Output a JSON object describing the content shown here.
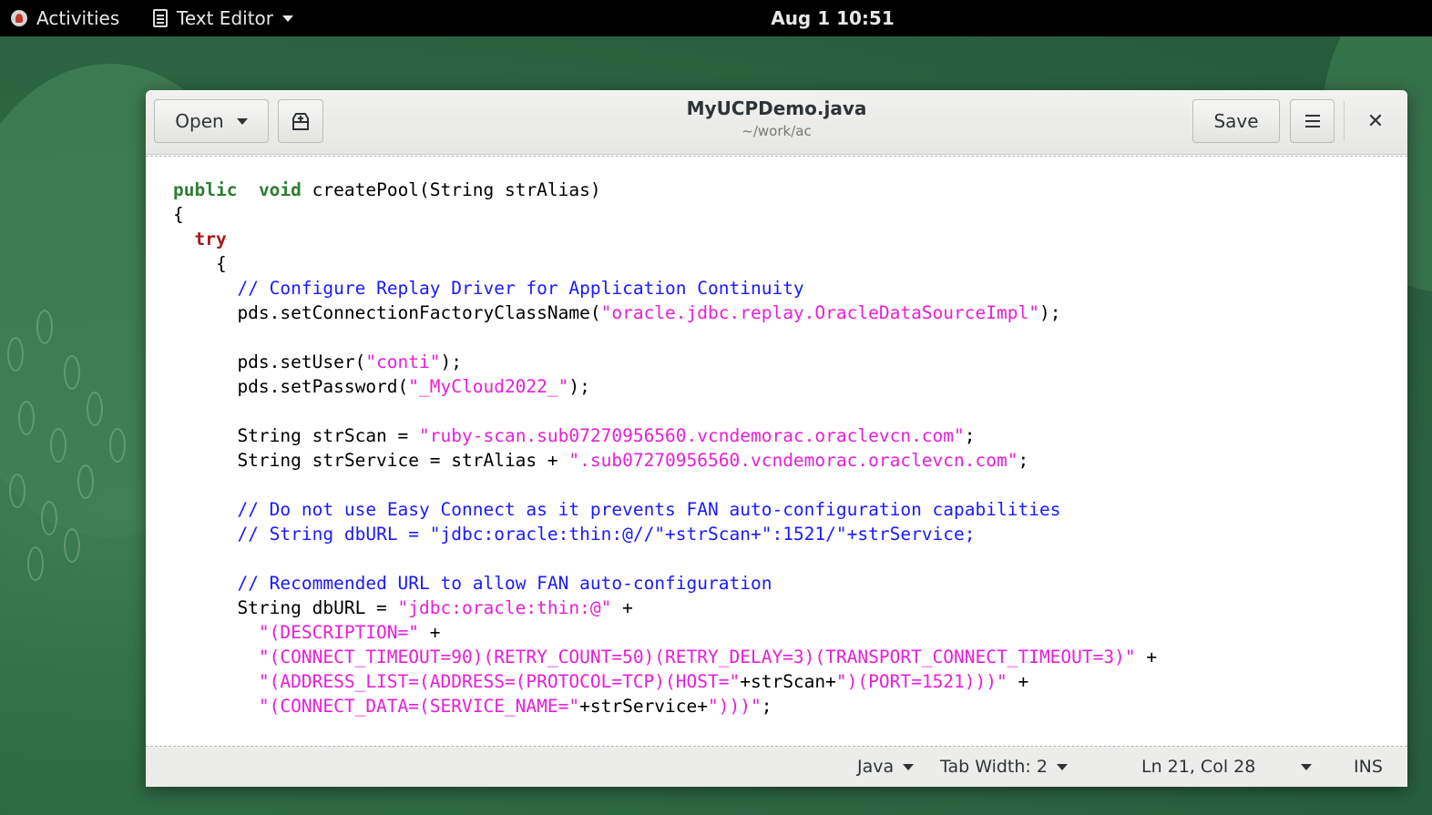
{
  "topbar": {
    "activities": "Activities",
    "app_name": "Text Editor",
    "clock": "Aug 1  10:51"
  },
  "window": {
    "title": "MyUCPDemo.java",
    "subtitle": "~/work/ac",
    "open_label": "Open",
    "save_label": "Save"
  },
  "code": {
    "lines": [
      [
        [
          "kw",
          "public"
        ],
        [
          "",
          "  "
        ],
        [
          "kw",
          "void"
        ],
        [
          "",
          " createPool(String strAlias)"
        ]
      ],
      [
        [
          "",
          "{"
        ]
      ],
      [
        [
          "",
          "  "
        ],
        [
          "kw2",
          "try"
        ]
      ],
      [
        [
          "",
          "    {"
        ]
      ],
      [
        [
          "",
          "      "
        ],
        [
          "cm",
          "// Configure Replay Driver for Application Continuity"
        ]
      ],
      [
        [
          "",
          "      pds.setConnectionFactoryClassName("
        ],
        [
          "st",
          "\"oracle.jdbc.replay.OracleDataSourceImpl\""
        ],
        [
          "",
          ");"
        ]
      ],
      [
        [
          "",
          ""
        ]
      ],
      [
        [
          "",
          "      pds.setUser("
        ],
        [
          "st",
          "\"conti\""
        ],
        [
          "",
          ");"
        ]
      ],
      [
        [
          "",
          "      pds.setPassword("
        ],
        [
          "st",
          "\"_MyCloud2022_\""
        ],
        [
          "",
          ");"
        ]
      ],
      [
        [
          "",
          ""
        ]
      ],
      [
        [
          "",
          "      String strScan = "
        ],
        [
          "st",
          "\"ruby-scan.sub07270956560.vcndemorac.oraclevcn.com\""
        ],
        [
          "",
          ";"
        ]
      ],
      [
        [
          "",
          "      String strService = strAlias + "
        ],
        [
          "st",
          "\".sub07270956560.vcndemorac.oraclevcn.com\""
        ],
        [
          "",
          ";"
        ]
      ],
      [
        [
          "",
          ""
        ]
      ],
      [
        [
          "",
          "      "
        ],
        [
          "cm",
          "// Do not use Easy Connect as it prevents FAN auto-configuration capabilities"
        ]
      ],
      [
        [
          "",
          "      "
        ],
        [
          "cm",
          "// String dbURL = \"jdbc:oracle:thin:@//\"+strScan+\":1521/\"+strService;"
        ]
      ],
      [
        [
          "",
          ""
        ]
      ],
      [
        [
          "",
          "      "
        ],
        [
          "cm",
          "// Recommended URL to allow FAN auto-configuration"
        ]
      ],
      [
        [
          "",
          "      String dbURL = "
        ],
        [
          "st",
          "\"jdbc:oracle:thin:@\""
        ],
        [
          "",
          " +"
        ]
      ],
      [
        [
          "",
          "        "
        ],
        [
          "st",
          "\"(DESCRIPTION=\""
        ],
        [
          "",
          " +"
        ]
      ],
      [
        [
          "",
          "        "
        ],
        [
          "st",
          "\"(CONNECT_TIMEOUT=90)(RETRY_COUNT=50)(RETRY_DELAY=3)(TRANSPORT_CONNECT_TIMEOUT=3)\""
        ],
        [
          "",
          " +"
        ]
      ],
      [
        [
          "",
          "        "
        ],
        [
          "st",
          "\"(ADDRESS_LIST=(ADDRESS=(PROTOCOL=TCP)(HOST=\""
        ],
        [
          "",
          "+strScan+"
        ],
        [
          "st",
          "\")(PORT=1521)))\""
        ],
        [
          "",
          " +"
        ]
      ],
      [
        [
          "",
          "        "
        ],
        [
          "st",
          "\"(CONNECT_DATA=(SERVICE_NAME=\""
        ],
        [
          "",
          "+strService+"
        ],
        [
          "st",
          "\")))\""
        ],
        [
          "",
          ";"
        ]
      ]
    ]
  },
  "statusbar": {
    "language": "Java",
    "tab_width": "Tab Width: 2",
    "position": "Ln 21, Col 28",
    "mode": "INS"
  },
  "colors": {
    "keyword": "#2e7d32",
    "control_keyword": "#a61b1b",
    "comment": "#1a1aff",
    "string": "#e81ed8",
    "desktop": "#2f6b45"
  },
  "icons": [
    "fedora-icon",
    "text-editor-icon",
    "new-tab-icon",
    "hamburger-menu-icon",
    "close-icon",
    "chevron-down-icon"
  ]
}
